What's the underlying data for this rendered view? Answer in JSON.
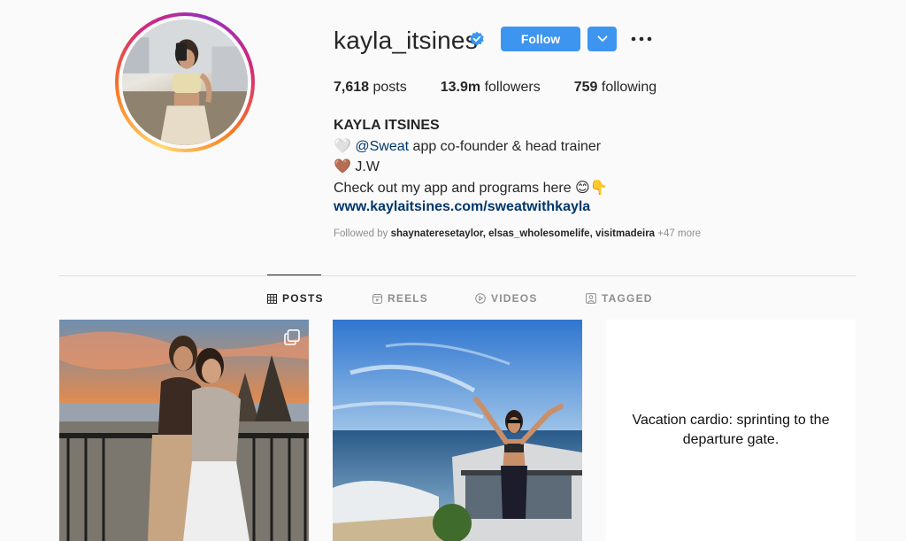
{
  "profile": {
    "username": "kayla_itsines",
    "verified": true,
    "follow_label": "Follow",
    "stats": {
      "posts_value": "7,618",
      "posts_label": "posts",
      "followers_value": "13.9m",
      "followers_label": "followers",
      "following_value": "759",
      "following_label": "following"
    },
    "full_name": "KAYLA ITSINES",
    "bio": {
      "line1_prefix": "🤍 ",
      "line1_mention": "@Sweat",
      "line1_rest": " app co-founder & head trainer",
      "line2": "🤎 J.W",
      "line3": "Check out my app and programs here 😊👇",
      "link": "www.kaylaitsines.com/sweatwithkayla"
    },
    "followed_by": {
      "prefix": "Followed by ",
      "users": "shaynateresetaylor, elsas_wholesomelife, visitmadeira",
      "more": " +47 more"
    }
  },
  "tabs": [
    {
      "label": "POSTS",
      "icon": "grid-icon",
      "active": true
    },
    {
      "label": "REELS",
      "icon": "reels-icon",
      "active": false
    },
    {
      "label": "VIDEOS",
      "icon": "video-icon",
      "active": false
    },
    {
      "label": "TAGGED",
      "icon": "tagged-icon",
      "active": false
    }
  ],
  "posts": [
    {
      "type": "photo",
      "multi": true,
      "description_icon": "carousel-icon"
    },
    {
      "type": "photo",
      "multi": false
    },
    {
      "type": "text",
      "caption": "Vacation cardio: sprinting to the departure gate."
    }
  ],
  "colors": {
    "follow_blue": "#3e95ef",
    "verified_blue": "#3897f0",
    "link_navy": "#00376b",
    "muted_gray": "#8e8e8e"
  }
}
